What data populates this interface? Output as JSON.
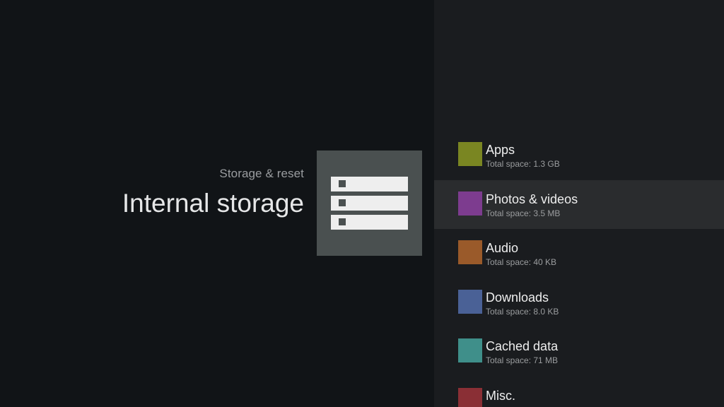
{
  "header": {
    "breadcrumb": "Storage & reset",
    "title": "Internal storage",
    "icon": "storage-icon"
  },
  "storage": {
    "items": [
      {
        "label": "Apps",
        "subtitle": "Total space: 1.3 GB",
        "color": "#7a8622",
        "focused": false
      },
      {
        "label": "Photos & videos",
        "subtitle": "Total space: 3.5 MB",
        "color": "#7d3c8f",
        "focused": true
      },
      {
        "label": "Audio",
        "subtitle": "Total space: 40 KB",
        "color": "#9a5a2a",
        "focused": false
      },
      {
        "label": "Downloads",
        "subtitle": "Total space: 8.0 KB",
        "color": "#4a6196",
        "focused": false
      },
      {
        "label": "Cached data",
        "subtitle": "Total space: 71 MB",
        "color": "#3f8f8a",
        "focused": false
      },
      {
        "label": "Misc.",
        "subtitle": "",
        "color": "#8a2f35",
        "focused": false
      }
    ]
  }
}
